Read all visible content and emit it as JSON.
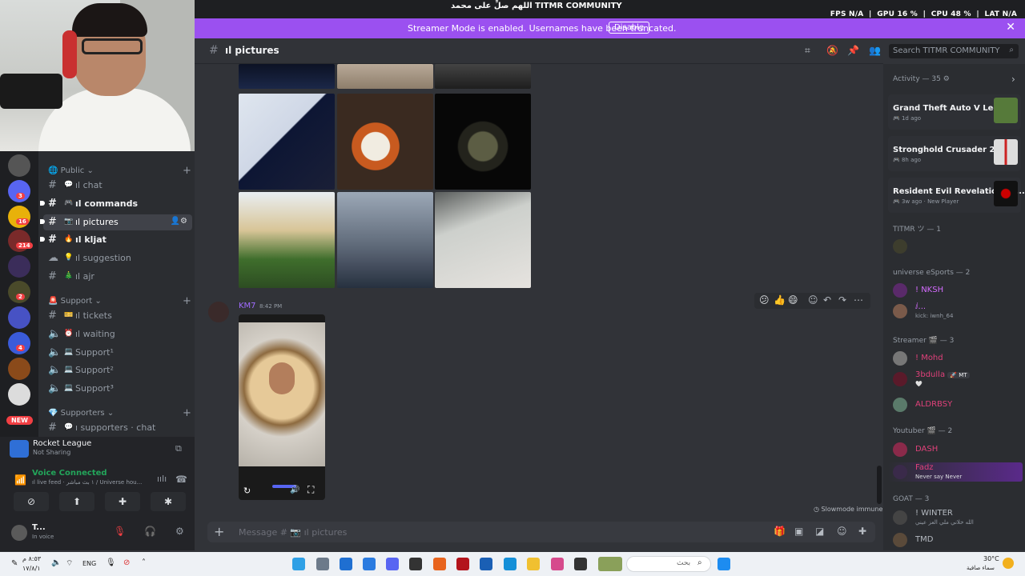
{
  "overlay": {
    "top_center": "اللهم صلِّ على محمد TITMR COMMUNITY",
    "fps_label": "FPS",
    "fps_value": "N/A",
    "gpu_label": "GPU",
    "gpu_value": "16 %",
    "cpu_label": "CPU",
    "cpu_value": "48 %",
    "lat_label": "LAT",
    "lat_value": "N/A"
  },
  "banner": {
    "message": "Streamer Mode is enabled. Usernames have been truncated.",
    "button": "Disable",
    "close": "✕"
  },
  "server_rail": {
    "badges": [
      "3",
      "16",
      "214",
      "2",
      "4"
    ],
    "new_label": "NEW"
  },
  "channels": {
    "categories": [
      {
        "label": "Public",
        "icon": "globe-icon"
      },
      {
        "label": "Support",
        "icon": "siren-icon"
      },
      {
        "label": "Supporters",
        "icon": "diamond-icon"
      }
    ],
    "items": [
      {
        "emoji": "💬",
        "label": "ıl chat"
      },
      {
        "emoji": "🎮",
        "label": "ıl commands"
      },
      {
        "emoji": "📷",
        "label": "ıl pictures"
      },
      {
        "emoji": "🔥",
        "label": "ıl kljat"
      },
      {
        "emoji": "💡",
        "label": "ıl suggestion"
      },
      {
        "emoji": "🎄",
        "label": "ıl ajr"
      },
      {
        "emoji": "🎫",
        "label": "ıl tickets"
      },
      {
        "emoji": "⏰",
        "label": "ıl waiting"
      },
      {
        "emoji": "💻",
        "label": "Support¹"
      },
      {
        "emoji": "💻",
        "label": "Support²"
      },
      {
        "emoji": "💻",
        "label": "Support³"
      },
      {
        "emoji": "💬",
        "label": "ı supporters · chat"
      }
    ]
  },
  "activity_panel": {
    "game": "Rocket League",
    "status": "Not Sharing"
  },
  "voice": {
    "title": "Voice Connected",
    "channel": "ıl live feed · ١ بث مباشر / Universe hou..."
  },
  "user": {
    "name": "T...",
    "status": "In voice"
  },
  "chat": {
    "channel_name": "ıl pictures",
    "message": {
      "author": "KM7",
      "time": "8:42 PM"
    },
    "composer_placeholder": "Message # 📷 ıl pictures",
    "slowmode": "Slowmode immune"
  },
  "members": {
    "search_placeholder": "Search TITMR COMMUNITY",
    "activity_header": "Activity — 35",
    "activities": [
      {
        "game": "Grand Theft Auto V Legacy",
        "time": "1d ago",
        "extra": ""
      },
      {
        "game": "Stronghold Crusader 2",
        "time": "8h ago",
        "extra": ""
      },
      {
        "game": "Resident Evil Revelations 2...",
        "time": "3w ago",
        "extra": "New Player"
      }
    ],
    "groups": [
      {
        "label": "TITMR ツ — 1"
      },
      {
        "label": "universe eSports — 2"
      },
      {
        "label": "Streamer 🎬 — 3"
      },
      {
        "label": "Youtuber 🎬 — 2"
      },
      {
        "label": "GOAT — 3"
      }
    ],
    "list": [
      {
        "name": "NKSH",
        "sub": "",
        "color": "#d56cff"
      },
      {
        "name": "",
        "sub": "kick: iwnh_64",
        "color": "#d56cff"
      },
      {
        "name": "Mohd",
        "sub": "",
        "color": "#e0417a"
      },
      {
        "name": "3bdulla",
        "sub": "🤍",
        "color": "#e0417a",
        "tag": "MT"
      },
      {
        "name": "ALDRBSY",
        "sub": "",
        "color": "#e0417a"
      },
      {
        "name": "DASH",
        "sub": "",
        "color": "#e0417a"
      },
      {
        "name": "Fadz",
        "sub": "Never say Never",
        "color": "#e0417a"
      },
      {
        "name": "WINTER",
        "sub": "الله خلاني ملي العز عيني",
        "color": "#b5bac1"
      },
      {
        "name": "TMD",
        "sub": "",
        "color": "#b5bac1"
      }
    ]
  },
  "taskbar": {
    "time": "٨:٥٣ م",
    "date": "١٧/٨/١",
    "lang": "ENG",
    "search_placeholder": "بحث",
    "weather_temp": "30°C",
    "weather_desc": "سماء صافية"
  }
}
